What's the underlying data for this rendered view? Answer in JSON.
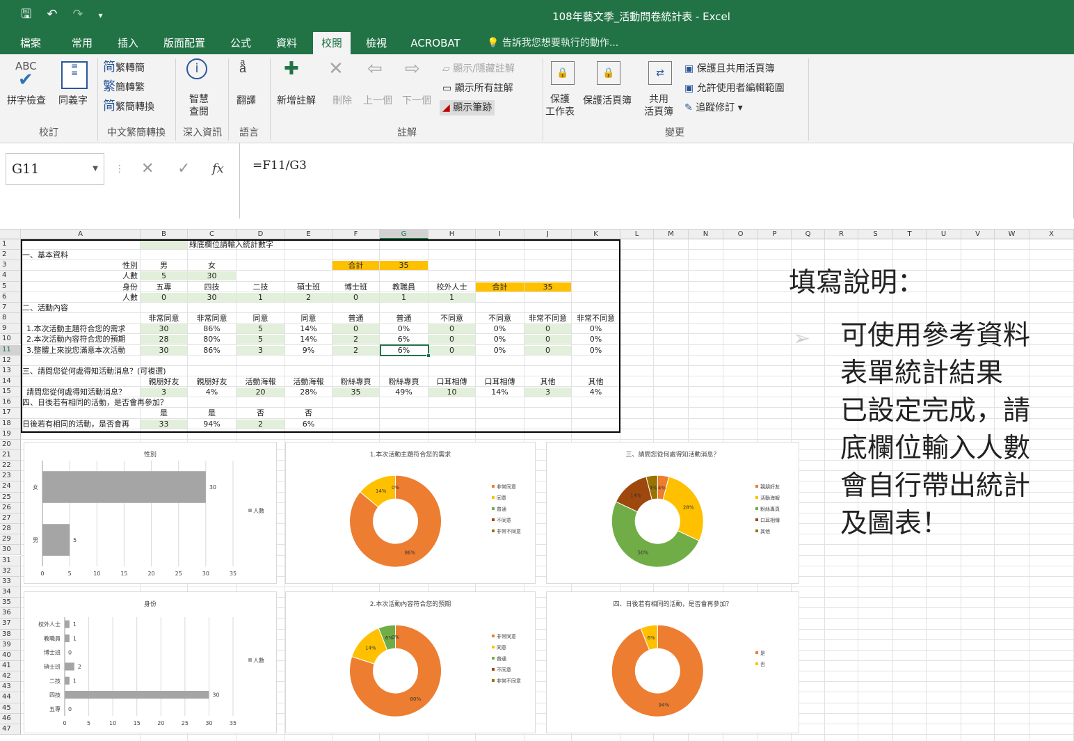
{
  "window": {
    "title": "108年藝文季_活動問卷統計表 - Excel",
    "qat": [
      "save-icon",
      "undo-icon",
      "redo-icon",
      "customize-icon"
    ]
  },
  "menu": {
    "tabs": [
      "檔案",
      "常用",
      "插入",
      "版面配置",
      "公式",
      "資料",
      "校閱",
      "檢視",
      "ACROBAT"
    ],
    "active": "校閱",
    "tellme": "告訴我您想要執行的動作..."
  },
  "ribbon": {
    "abc": "ABC",
    "spell": "拼字檢查",
    "thesaurus": "同義字",
    "t2s": "繁轉簡",
    "s2t": "簡轉繁",
    "conv": "繁簡轉換",
    "smart1": "智慧",
    "smart2": "查閱",
    "translate": "翻譯",
    "newcomment": "新增註解",
    "delete": "刪除",
    "prev": "上一個",
    "next": "下一個",
    "showhide": "顯示/隱藏註解",
    "showall": "顯示所有註解",
    "showink": "顯示筆跡",
    "protsheet1": "保護",
    "protsheet2": "工作表",
    "protbook": "保護活頁簿",
    "share1": "共用",
    "share2": "活頁簿",
    "protshare": "保護且共用活頁簿",
    "allowedit": "允許使用者編輯範圍",
    "track": "追蹤修訂 ▾",
    "groups": {
      "proof": "校訂",
      "chinese": "中文繁簡轉換",
      "insights": "深入資訊",
      "language": "語言",
      "comments": "註解",
      "changes": "變更"
    }
  },
  "formula": {
    "namebox": "G11",
    "fx": "fx",
    "cancel": "✕",
    "enter": "✓",
    "value": "=F11/G3"
  },
  "sheet": {
    "columns": [
      "A",
      "B",
      "C",
      "D",
      "E",
      "F",
      "G",
      "H",
      "I",
      "J",
      "K",
      "L",
      "M",
      "N",
      "O",
      "P",
      "Q",
      "R",
      "S",
      "T",
      "U",
      "V",
      "W",
      "X"
    ],
    "rows": [
      "1",
      "2",
      "3",
      "4",
      "5",
      "6",
      "7",
      "8",
      "9",
      "10",
      "11",
      "12",
      "13",
      "14",
      "15",
      "16",
      "17",
      "18",
      "19",
      "20",
      "21",
      "22",
      "23",
      "24",
      "25",
      "26",
      "27",
      "28",
      "29",
      "30",
      "31",
      "32",
      "33",
      "34",
      "35",
      "36",
      "37",
      "38",
      "39",
      "40",
      "41",
      "42",
      "43",
      "44",
      "45",
      "46",
      "47"
    ],
    "cells": {
      "r1": {
        "C": "綠底欄位請輸入統計數字"
      },
      "r2": {
        "A": "一、基本資料"
      },
      "r3": {
        "A": "性別",
        "B": "男",
        "C": "女",
        "F": "合計",
        "G": "35"
      },
      "r4": {
        "A": "人數",
        "B": "5",
        "C": "30"
      },
      "r5": {
        "A": "身份",
        "B": "五專",
        "C": "四技",
        "D": "二技",
        "E": "碩士班",
        "F": "博士班",
        "G": "教職員",
        "H": "校外人士",
        "I": "合計",
        "J": "35"
      },
      "r6": {
        "A": "人數",
        "B": "0",
        "C": "30",
        "D": "1",
        "E": "2",
        "F": "0",
        "G": "1",
        "H": "1"
      },
      "r7": {
        "A": "二、活動內容"
      },
      "r8": {
        "B": "非常同意",
        "C": "非常同意",
        "D": "同意",
        "E": "同意",
        "F": "普通",
        "G": "普通",
        "H": "不同意",
        "I": "不同意",
        "J": "非常不同意",
        "K": "非常不同意"
      },
      "r9": {
        "A": "1.本次活動主題符合您的需求",
        "B": "30",
        "C": "86%",
        "D": "5",
        "E": "14%",
        "F": "0",
        "G": "0%",
        "H": "0",
        "I": "0%",
        "J": "0",
        "K": "0%"
      },
      "r10": {
        "A": "2.本次活動內容符合您的預期",
        "B": "28",
        "C": "80%",
        "D": "5",
        "E": "14%",
        "F": "2",
        "G": "6%",
        "H": "0",
        "I": "0%",
        "J": "0",
        "K": "0%"
      },
      "r11": {
        "A": "3.整體上來說您滿意本次活動",
        "B": "30",
        "C": "86%",
        "D": "3",
        "E": "9%",
        "F": "2",
        "G": "6%",
        "H": "0",
        "I": "0%",
        "J": "0",
        "K": "0%"
      },
      "r13": {
        "A": "三、請問您從何處得知活動消息？(可複選)"
      },
      "r14": {
        "B": "親朋好友",
        "C": "親朋好友",
        "D": "活動海報",
        "E": "活動海報",
        "F": "粉絲專頁",
        "G": "粉絲專頁",
        "H": "口耳相傳",
        "I": "口耳相傳",
        "J": "其他",
        "K": "其他"
      },
      "r15": {
        "A": "請問您從何處得知活動消息？",
        "B": "3",
        "C": "4%",
        "D": "20",
        "E": "28%",
        "F": "35",
        "G": "49%",
        "H": "10",
        "I": "14%",
        "J": "3",
        "K": "4%"
      },
      "r16": {
        "A": "四、日後若有相同的活動，是否會再參加？"
      },
      "r17": {
        "B": "是",
        "C": "是",
        "D": "否",
        "E": "否"
      },
      "r18": {
        "A": "日後若有相同的活動，是否會再",
        "B": "33",
        "C": "94%",
        "D": "2",
        "E": "6%"
      }
    }
  },
  "note": {
    "head": "填寫說明：",
    "body": "可使用參考資料\n表單統計結果\n已設定完成，請\n底欄位輸入人數\n會自行帶出統計\n及圖表！"
  },
  "colors": {
    "excel_green": "#217346",
    "orange": "#ed7d31",
    "yellow": "#ffc000",
    "green": "#70ad47",
    "brown": "#9e480e",
    "olive": "#997300",
    "gray": "#a5a5a5"
  },
  "chart_data": [
    {
      "type": "bar",
      "orientation": "horizontal",
      "title": "性別",
      "categories": [
        "女",
        "男"
      ],
      "series": [
        {
          "name": "人數",
          "values": [
            30,
            5
          ]
        }
      ],
      "xlim": [
        0,
        35
      ],
      "ticks": [
        "0",
        "5",
        "10",
        "15",
        "20",
        "25",
        "30",
        "35"
      ],
      "legend": "right"
    },
    {
      "type": "pie",
      "donut": true,
      "title": "1.本次活動主題符合您的需求",
      "categories": [
        "非常同意",
        "同意",
        "普通",
        "不同意",
        "非常不同意"
      ],
      "values": [
        86,
        14,
        0,
        0,
        0
      ],
      "labels": [
        "86%",
        "14%",
        "0%",
        "",
        ""
      ],
      "legend": "right"
    },
    {
      "type": "pie",
      "donut": true,
      "title": "三、請問您從何處得知活動消息？",
      "categories": [
        "親朋好友",
        "活動海報",
        "粉絲專頁",
        "口耳相傳",
        "其他"
      ],
      "values": [
        4,
        28,
        50,
        14,
        4
      ],
      "labels": [
        "4%",
        "28%",
        "50%",
        "14%",
        "4%"
      ],
      "legend": "right"
    },
    {
      "type": "bar",
      "orientation": "horizontal",
      "title": "身份",
      "categories": [
        "校外人士",
        "教職員",
        "博士班",
        "碩士班",
        "二技",
        "四技",
        "五專"
      ],
      "series": [
        {
          "name": "人數",
          "values": [
            1,
            1,
            0,
            2,
            1,
            30,
            0
          ]
        }
      ],
      "xlim": [
        0,
        35
      ],
      "ticks": [
        "0",
        "5",
        "10",
        "15",
        "20",
        "25",
        "30",
        "35"
      ],
      "legend": "right"
    },
    {
      "type": "pie",
      "donut": true,
      "title": "2.本次活動內容符合您的預期",
      "categories": [
        "非常同意",
        "同意",
        "普通",
        "不同意",
        "非常不同意"
      ],
      "values": [
        80,
        14,
        6,
        0,
        0
      ],
      "labels": [
        "80%",
        "14%",
        "6%",
        "0%",
        ""
      ],
      "legend": "right"
    },
    {
      "type": "pie",
      "donut": true,
      "title": "四、日後若有相同的活動，是否會再參加？",
      "categories": [
        "是",
        "否"
      ],
      "values": [
        94,
        6
      ],
      "labels": [
        "94%",
        "6%"
      ],
      "legend": "right"
    }
  ]
}
